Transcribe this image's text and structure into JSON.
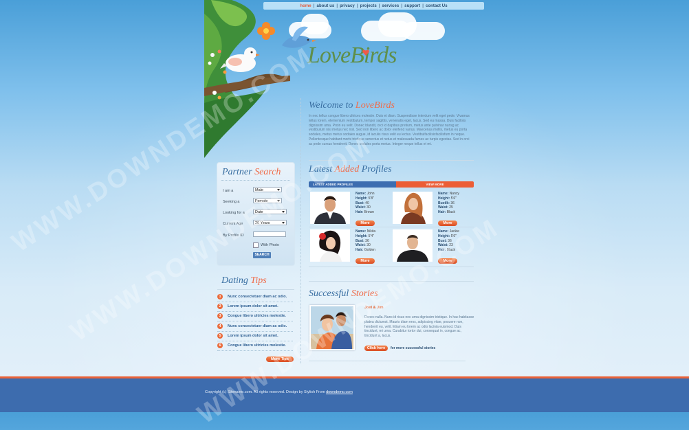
{
  "nav": {
    "items": [
      "home",
      "about us",
      "privacy",
      "projects",
      "services",
      "support",
      "contact Us"
    ],
    "active": "home",
    "separator": "|"
  },
  "logo": {
    "text1": "Love",
    "text2": "Birds"
  },
  "watermark": "WWW.DOWNDEMO.COM",
  "welcome": {
    "title_pre": "Welcome to ",
    "title_hl": "LoveBirds",
    "body": "In nec tellus congue libero ultrices molestie. Duis et diam. Suspendisse interdum velit eget pede. Vivamus tellus lorem, elementum vestibulum, tempor sagittis, venenatis eget, lacus. Sed eu massa. Duis facilisis dignissim uma. Proin eu velit. Donec blandit, orci id dapibus pretium, metus ante pulvinar nunsg ac vestibulum nisi metus nec nisl. Sed non libero ac dolor eleifend varius. Maecenas mollis, metus eu porta sodales, metus metus sodales augue, id iaculis risus velit eu lectus. Vestibulfacilisisfacilisfum in neque. Pellentesque habitant morbi tristique senectus et netus et malesuada fames ac turpis egestas. Sed in orci ac pede cursus hendrerit. Donec sodales porta metus. Integer neque tellus et mi."
  },
  "partner_search": {
    "title_pre": "Partner ",
    "title_hl": "Search",
    "fields": [
      {
        "label": "I am a",
        "value": "Male"
      },
      {
        "label": "Seeking a",
        "value": "Female"
      },
      {
        "label": "Looking for a",
        "value": "Date"
      },
      {
        "label": "Current Age",
        "value": "26 Years"
      },
      {
        "label": "By Profile ID",
        "value": ""
      }
    ],
    "with_photo_label": "With Photo",
    "search_button": "SEARCH"
  },
  "dating_tips": {
    "title_pre": "Dating ",
    "title_hl": "Tips",
    "items": [
      {
        "num": "1",
        "text": "Nunc consectetuer diam ac odio."
      },
      {
        "num": "2",
        "text": "Lorem ipsum dolor sit amet."
      },
      {
        "num": "3",
        "text": "Congue libero ultricies molestie."
      },
      {
        "num": "4",
        "text": "Nunc consectetuer diam ac odio."
      },
      {
        "num": "5",
        "text": "Lorem ipsum dolor sit amet."
      },
      {
        "num": "6",
        "text": "Congue libero ultricies molestie."
      }
    ],
    "more_button": "More Tips"
  },
  "latest": {
    "title_pre": "Latest ",
    "title_hl": "Added",
    "title_post": " Profiles",
    "bar_left": "LATEST ADDED PROFILES",
    "bar_right": "VIEW MORE",
    "labels": {
      "name": "Name:",
      "height": "Height:",
      "bust": "Bust:",
      "waist": "Waist:",
      "hair": "Hair:"
    },
    "profiles": [
      {
        "name": "John",
        "height": "5'8\"",
        "bust_label": "Bust:",
        "bust": "40",
        "waist": "30",
        "hair": "Brown",
        "more": "More"
      },
      {
        "name": "Nancy",
        "height": "5'6\"",
        "bust_label": "Bustlk:",
        "bust": "36",
        "waist": "25",
        "hair": "Black",
        "more": "More"
      },
      {
        "name": "Nikita",
        "height": "5'4\"",
        "bust_label": "Bust:",
        "bust": "36",
        "waist": "30",
        "hair": "Golden",
        "more": "More"
      },
      {
        "name": "Jackie",
        "height": "5'6\"",
        "bust_label": "Bust:",
        "bust": "36",
        "waist": "23",
        "hair": "Black",
        "more": "More"
      }
    ]
  },
  "stories": {
    "title_pre": "Successful ",
    "title_hl": "Stories",
    "couple": "Joel & Jim",
    "body": "Donec nulla. Nunc id risus nec urna dignissim tristique. In hac habitasse platea dictumst. Mauris diam eros, adipiscing vitae, posuere non, hendrerit eu, velit. Etiam eu lorem ac odio lacinia euismod. Duis tincidunt, mi urna. Curabitur tortor dui, consequat in, congue ac, tincidunt a, lacus.",
    "button": "Click here",
    "link_text": "for more successful stories"
  },
  "footer": {
    "text": "Copyright (c) Sitename.com. All rights reserved. Design by Stylish From ",
    "link": "downdemo.com"
  },
  "colors": {
    "accent": "#f06c4a",
    "primary": "#3a6fa2",
    "footer_bg": "#3d6cae"
  }
}
